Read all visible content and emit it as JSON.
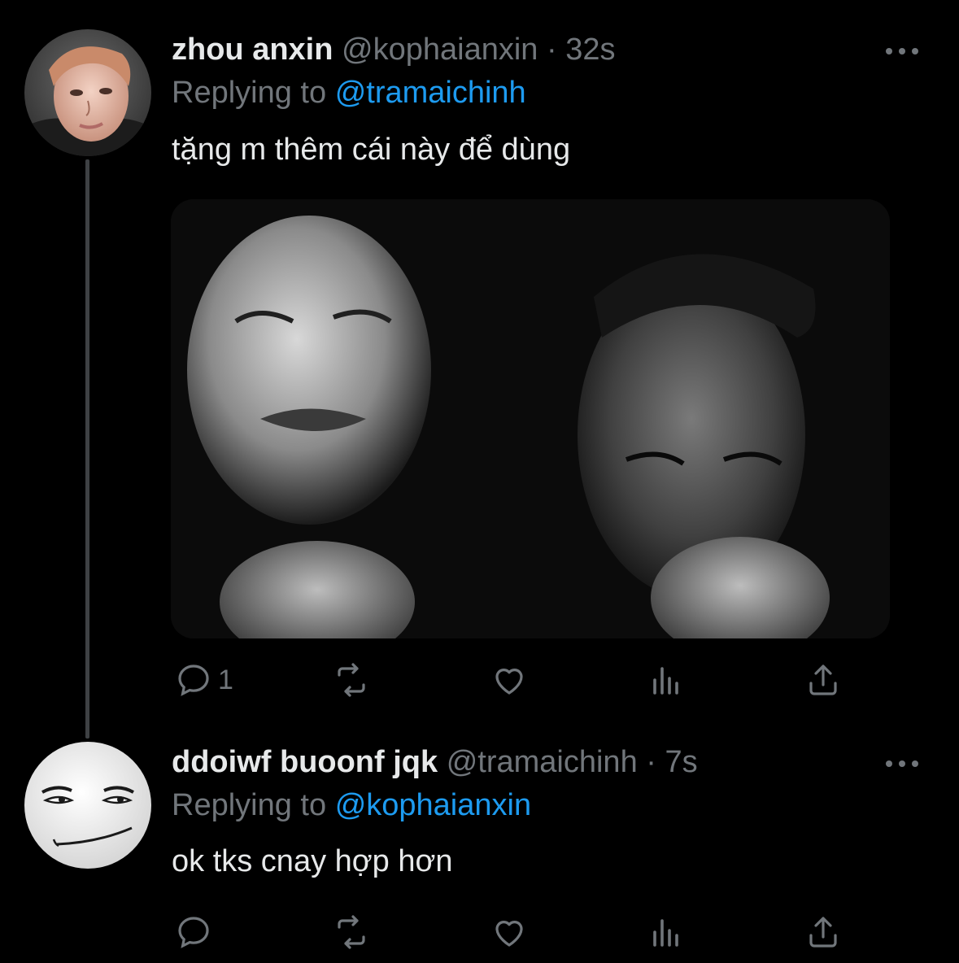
{
  "thread": [
    {
      "display_name": "zhou anxin",
      "handle": "@kophaianxin",
      "separator": "·",
      "time": "32s",
      "replying_prefix": "Replying to",
      "replying_to": "@tramaichinh",
      "text": "tặng m thêm cái này để dùng",
      "avatar_icon": "profile-photo",
      "has_media": true,
      "actions": {
        "reply_count": "1",
        "retweet_count": "",
        "like_count": ""
      }
    },
    {
      "display_name": "ddoiwf buoonf jqk",
      "handle": "@tramaichinh",
      "separator": "·",
      "time": "7s",
      "replying_prefix": "Replying to",
      "replying_to": "@kophaianxin",
      "text": "ok tks cnay hợp hơn",
      "avatar_icon": "meme-face",
      "has_media": false,
      "actions": {
        "reply_count": "",
        "retweet_count": "",
        "like_count": ""
      }
    }
  ],
  "colors": {
    "background": "#000000",
    "primary_text": "#e7e9ea",
    "secondary_text": "#71767b",
    "link": "#1d9bf0",
    "thread_line": "#3e4144"
  }
}
